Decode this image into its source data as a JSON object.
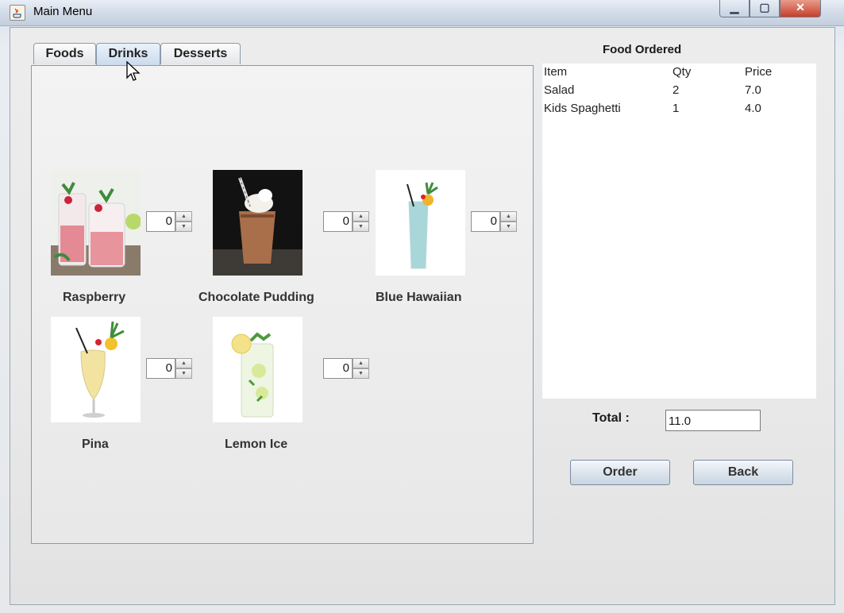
{
  "window": {
    "title": "Main Menu",
    "min_glyph": "▁",
    "max_glyph": "▢",
    "close_glyph": "✕"
  },
  "tabs": [
    {
      "label": "Foods"
    },
    {
      "label": "Drinks"
    },
    {
      "label": "Desserts"
    }
  ],
  "active_tab": "Drinks",
  "drinks": [
    {
      "name": "Raspberry",
      "qty": "0",
      "icon": "raspberry-drink"
    },
    {
      "name": "Chocolate Pudding",
      "qty": "0",
      "icon": "chocolate-shake"
    },
    {
      "name": "Blue Hawaiian",
      "label": "Blue Hawaiian",
      "qty": "0",
      "icon": "blue-cocktail"
    },
    {
      "name": "Pina",
      "qty": "0",
      "icon": "pina-colada"
    },
    {
      "name": "Lemon Ice",
      "qty": "0",
      "icon": "lemon-ice"
    }
  ],
  "order": {
    "title": "Food Ordered",
    "columns": [
      "Item",
      "Qty",
      "Price"
    ],
    "rows": [
      {
        "item": "Salad",
        "qty": "2",
        "price": "7.0"
      },
      {
        "item": "Kids Spaghetti",
        "qty": "1",
        "price": "4.0"
      }
    ],
    "total_label": "Total :",
    "total_value": "11.0"
  },
  "buttons": {
    "order": "Order",
    "back": "Back"
  },
  "spinner_up": "▲",
  "spinner_down": "▼"
}
